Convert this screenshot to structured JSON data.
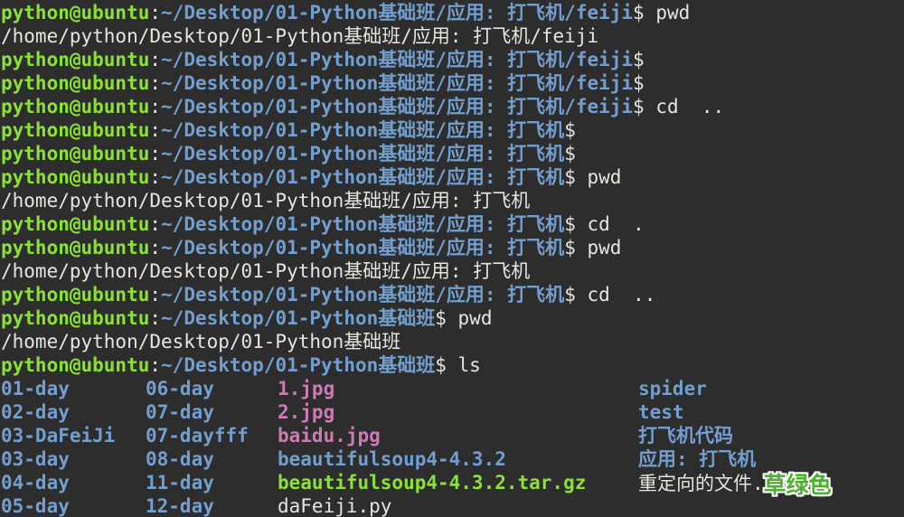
{
  "terminal": {
    "colors": {
      "background": "#2d2d2d",
      "prompt_user_green": "#8ae234",
      "path_blue": "#729fcf",
      "text_white": "#e6e6e1",
      "image_file_pink": "#cd7bb4",
      "archive_file_green": "#8ae234",
      "annotation_green": "#4db02e",
      "annotation_outline": "#ffffff"
    },
    "prompt": {
      "user_host": "python@ubuntu",
      "separator": ":",
      "path_feiji": "~/Desktop/01-Python基础班/应用: 打飞机/feiji",
      "path_app": "~/Desktop/01-Python基础班/应用: 打飞机",
      "path_base": "~/Desktop/01-Python基础班"
    },
    "lines": [
      {
        "segments": [
          {
            "t": "python@ubuntu",
            "c": "user",
            "n": "prompt-user"
          },
          {
            "t": ":",
            "c": "sep",
            "n": "prompt-separator"
          },
          {
            "t": "~/Desktop/01-Python基础班/应用: 打飞机/feiji",
            "c": "path",
            "n": "prompt-path"
          },
          {
            "t": "$ pwd",
            "c": "cmd",
            "n": "prompt-command"
          }
        ]
      },
      {
        "segments": [
          {
            "t": "/home/python/Desktop/01-Python基础班/应用: 打飞机/feiji",
            "c": "out",
            "n": "command-output"
          }
        ]
      },
      {
        "segments": [
          {
            "t": "python@ubuntu",
            "c": "user",
            "n": "prompt-user"
          },
          {
            "t": ":",
            "c": "sep",
            "n": "prompt-separator"
          },
          {
            "t": "~/Desktop/01-Python基础班/应用: 打飞机/feiji",
            "c": "path",
            "n": "prompt-path"
          },
          {
            "t": "$",
            "c": "cmd",
            "n": "prompt-command"
          }
        ]
      },
      {
        "segments": [
          {
            "t": "python@ubuntu",
            "c": "user",
            "n": "prompt-user"
          },
          {
            "t": ":",
            "c": "sep",
            "n": "prompt-separator"
          },
          {
            "t": "~/Desktop/01-Python基础班/应用: 打飞机/feiji",
            "c": "path",
            "n": "prompt-path"
          },
          {
            "t": "$",
            "c": "cmd",
            "n": "prompt-command"
          }
        ]
      },
      {
        "segments": [
          {
            "t": "python@ubuntu",
            "c": "user",
            "n": "prompt-user"
          },
          {
            "t": ":",
            "c": "sep",
            "n": "prompt-separator"
          },
          {
            "t": "~/Desktop/01-Python基础班/应用: 打飞机/feiji",
            "c": "path",
            "n": "prompt-path"
          },
          {
            "t": "$ cd  ..",
            "c": "cmd",
            "n": "prompt-command"
          }
        ]
      },
      {
        "segments": [
          {
            "t": "python@ubuntu",
            "c": "user",
            "n": "prompt-user"
          },
          {
            "t": ":",
            "c": "sep",
            "n": "prompt-separator"
          },
          {
            "t": "~/Desktop/01-Python基础班/应用: 打飞机",
            "c": "path",
            "n": "prompt-path"
          },
          {
            "t": "$",
            "c": "cmd",
            "n": "prompt-command"
          }
        ]
      },
      {
        "segments": [
          {
            "t": "python@ubuntu",
            "c": "user",
            "n": "prompt-user"
          },
          {
            "t": ":",
            "c": "sep",
            "n": "prompt-separator"
          },
          {
            "t": "~/Desktop/01-Python基础班/应用: 打飞机",
            "c": "path",
            "n": "prompt-path"
          },
          {
            "t": "$",
            "c": "cmd",
            "n": "prompt-command"
          }
        ]
      },
      {
        "segments": [
          {
            "t": "python@ubuntu",
            "c": "user",
            "n": "prompt-user"
          },
          {
            "t": ":",
            "c": "sep",
            "n": "prompt-separator"
          },
          {
            "t": "~/Desktop/01-Python基础班/应用: 打飞机",
            "c": "path",
            "n": "prompt-path"
          },
          {
            "t": "$ pwd",
            "c": "cmd",
            "n": "prompt-command"
          }
        ]
      },
      {
        "segments": [
          {
            "t": "/home/python/Desktop/01-Python基础班/应用: 打飞机",
            "c": "out",
            "n": "command-output"
          }
        ]
      },
      {
        "segments": [
          {
            "t": "python@ubuntu",
            "c": "user",
            "n": "prompt-user"
          },
          {
            "t": ":",
            "c": "sep",
            "n": "prompt-separator"
          },
          {
            "t": "~/Desktop/01-Python基础班/应用: 打飞机",
            "c": "path",
            "n": "prompt-path"
          },
          {
            "t": "$ cd  .",
            "c": "cmd",
            "n": "prompt-command"
          }
        ]
      },
      {
        "segments": [
          {
            "t": "python@ubuntu",
            "c": "user",
            "n": "prompt-user"
          },
          {
            "t": ":",
            "c": "sep",
            "n": "prompt-separator"
          },
          {
            "t": "~/Desktop/01-Python基础班/应用: 打飞机",
            "c": "path",
            "n": "prompt-path"
          },
          {
            "t": "$ pwd",
            "c": "cmd",
            "n": "prompt-command"
          }
        ]
      },
      {
        "segments": [
          {
            "t": "/home/python/Desktop/01-Python基础班/应用: 打飞机",
            "c": "out",
            "n": "command-output"
          }
        ]
      },
      {
        "segments": [
          {
            "t": "python@ubuntu",
            "c": "user",
            "n": "prompt-user"
          },
          {
            "t": ":",
            "c": "sep",
            "n": "prompt-separator"
          },
          {
            "t": "~/Desktop/01-Python基础班/应用: 打飞机",
            "c": "path",
            "n": "prompt-path"
          },
          {
            "t": "$ cd  ..",
            "c": "cmd",
            "n": "prompt-command"
          }
        ]
      },
      {
        "segments": [
          {
            "t": "python@ubuntu",
            "c": "user",
            "n": "prompt-user"
          },
          {
            "t": ":",
            "c": "sep",
            "n": "prompt-separator"
          },
          {
            "t": "~/Desktop/01-Python基础班",
            "c": "path",
            "n": "prompt-path"
          },
          {
            "t": "$ pwd",
            "c": "cmd",
            "n": "prompt-command"
          }
        ]
      },
      {
        "segments": [
          {
            "t": "/home/python/Desktop/01-Python基础班",
            "c": "out",
            "n": "command-output"
          }
        ]
      },
      {
        "segments": [
          {
            "t": "python@ubuntu",
            "c": "user",
            "n": "prompt-user"
          },
          {
            "t": ":",
            "c": "sep",
            "n": "prompt-separator"
          },
          {
            "t": "~/Desktop/01-Python基础班",
            "c": "path",
            "n": "prompt-path"
          },
          {
            "t": "$ ls",
            "c": "cmd",
            "n": "prompt-command"
          }
        ]
      }
    ],
    "ls": {
      "col_x": [
        0,
        160,
        306,
        705
      ],
      "rows": [
        {
          "cells": [
            {
              "t": "01-day",
              "c": "dir"
            },
            {
              "t": "06-day",
              "c": "dir"
            },
            {
              "t": "1.jpg",
              "c": "img"
            },
            {
              "t": "spider",
              "c": "dir"
            }
          ]
        },
        {
          "cells": [
            {
              "t": "02-day",
              "c": "dir"
            },
            {
              "t": "07-day",
              "c": "dir"
            },
            {
              "t": "2.jpg",
              "c": "img"
            },
            {
              "t": "test",
              "c": "dir"
            }
          ]
        },
        {
          "cells": [
            {
              "t": "03-DaFeiJi",
              "c": "dir"
            },
            {
              "t": "07-dayfff",
              "c": "dir"
            },
            {
              "t": "baidu.jpg",
              "c": "img"
            },
            {
              "t": "打飞机代码",
              "c": "dir"
            }
          ]
        },
        {
          "cells": [
            {
              "t": "03-day",
              "c": "dir"
            },
            {
              "t": "08-day",
              "c": "dir"
            },
            {
              "t": "beautifulsoup4-4.3.2",
              "c": "dir"
            },
            {
              "t": "应用: 打飞机",
              "c": "dir"
            }
          ]
        },
        {
          "cells": [
            {
              "t": "04-day",
              "c": "dir"
            },
            {
              "t": "11-day",
              "c": "dir"
            },
            {
              "t": "beautifulsoup4-4.3.2.tar.gz",
              "c": "arch"
            },
            {
              "t": "重定向的文件.",
              "c": "plain",
              "annotation": "草绿色"
            }
          ]
        },
        {
          "cells": [
            {
              "t": "05-day",
              "c": "dir"
            },
            {
              "t": "12-day",
              "c": "dir"
            },
            {
              "t": "daFeiji.py",
              "c": "plain"
            },
            null
          ]
        }
      ]
    },
    "annotation": {
      "text": "草绿色",
      "color": "#4db02e"
    }
  }
}
